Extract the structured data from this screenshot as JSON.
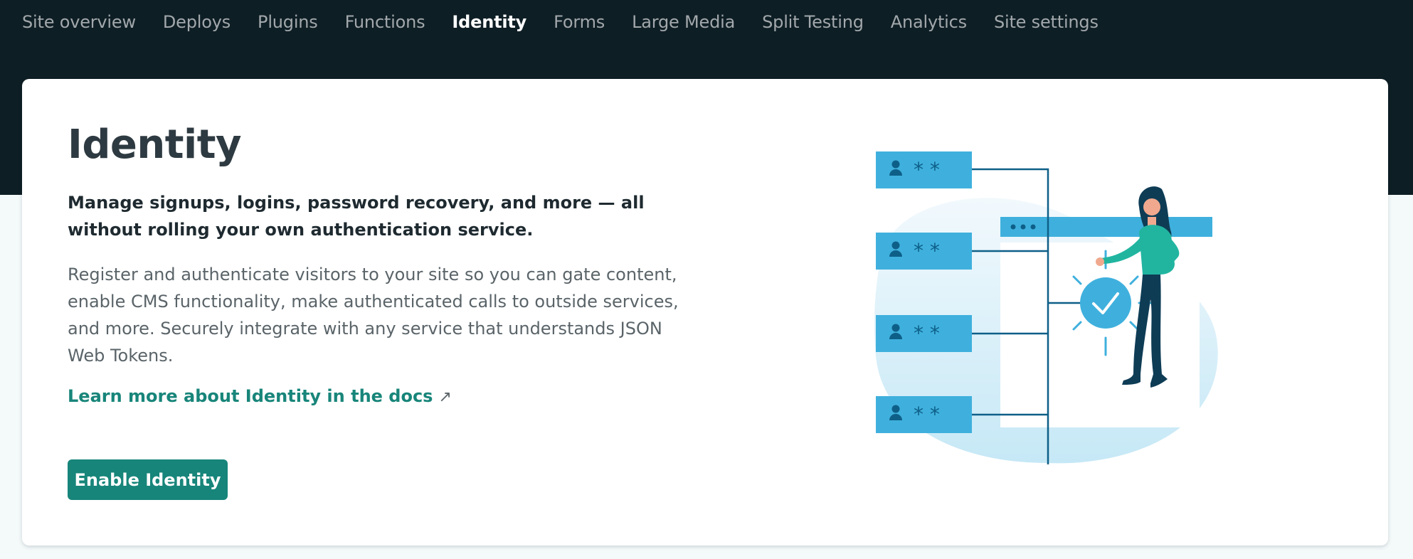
{
  "nav": {
    "items": [
      {
        "label": "Site overview",
        "active": false
      },
      {
        "label": "Deploys",
        "active": false
      },
      {
        "label": "Plugins",
        "active": false
      },
      {
        "label": "Functions",
        "active": false
      },
      {
        "label": "Identity",
        "active": true
      },
      {
        "label": "Forms",
        "active": false
      },
      {
        "label": "Large Media",
        "active": false
      },
      {
        "label": "Split Testing",
        "active": false
      },
      {
        "label": "Analytics",
        "active": false
      },
      {
        "label": "Site settings",
        "active": false
      }
    ]
  },
  "main": {
    "title": "Identity",
    "lede": "Manage signups, logins, password recovery, and more — all without rolling your own authentication service.",
    "description": "Register and authenticate visitors to your site so you can gate content, enable CMS functionality, make authenticated calls to outside services, and more. Securely integrate with any service that understands JSON Web Tokens.",
    "docs_link": {
      "label": "Learn more about Identity in the docs",
      "icon": "external-link-icon",
      "arrow": "↗"
    },
    "enable_button": "Enable Identity",
    "illustration": {
      "icon": "identity-illustration",
      "password_mask": "* *"
    }
  },
  "colors": {
    "header_bg": "#0e1e25",
    "nav_text": "#a2a8ab",
    "nav_active": "#ffffff",
    "accent": "#17857a",
    "illustration_blue": "#3fb0dd"
  }
}
